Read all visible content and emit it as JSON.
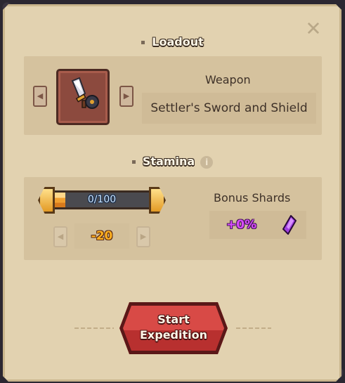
{
  "close": {
    "icon": "close-x-icon"
  },
  "loadout": {
    "title": "Loadout",
    "weapon_label": "Weapon",
    "weapon_name": "Settler's Sword and Shield",
    "weapon_icon": "sword-and-shield-icon"
  },
  "stamina": {
    "title": "Stamina",
    "info_glyph": "i",
    "current": 0,
    "max": 100,
    "bar_text": "0/100",
    "fill_fraction": 0.12,
    "cost": "-20"
  },
  "bonus": {
    "label": "Bonus Shards",
    "value": "+0%",
    "icon": "purple-shard-icon"
  },
  "start": {
    "line1": "Start",
    "line2": "Expedition"
  },
  "colors": {
    "parchment": "#e2d2b0",
    "button_red": "#c83a3a",
    "shard_purple": "#d84cff",
    "cost_orange": "#ffb020"
  }
}
